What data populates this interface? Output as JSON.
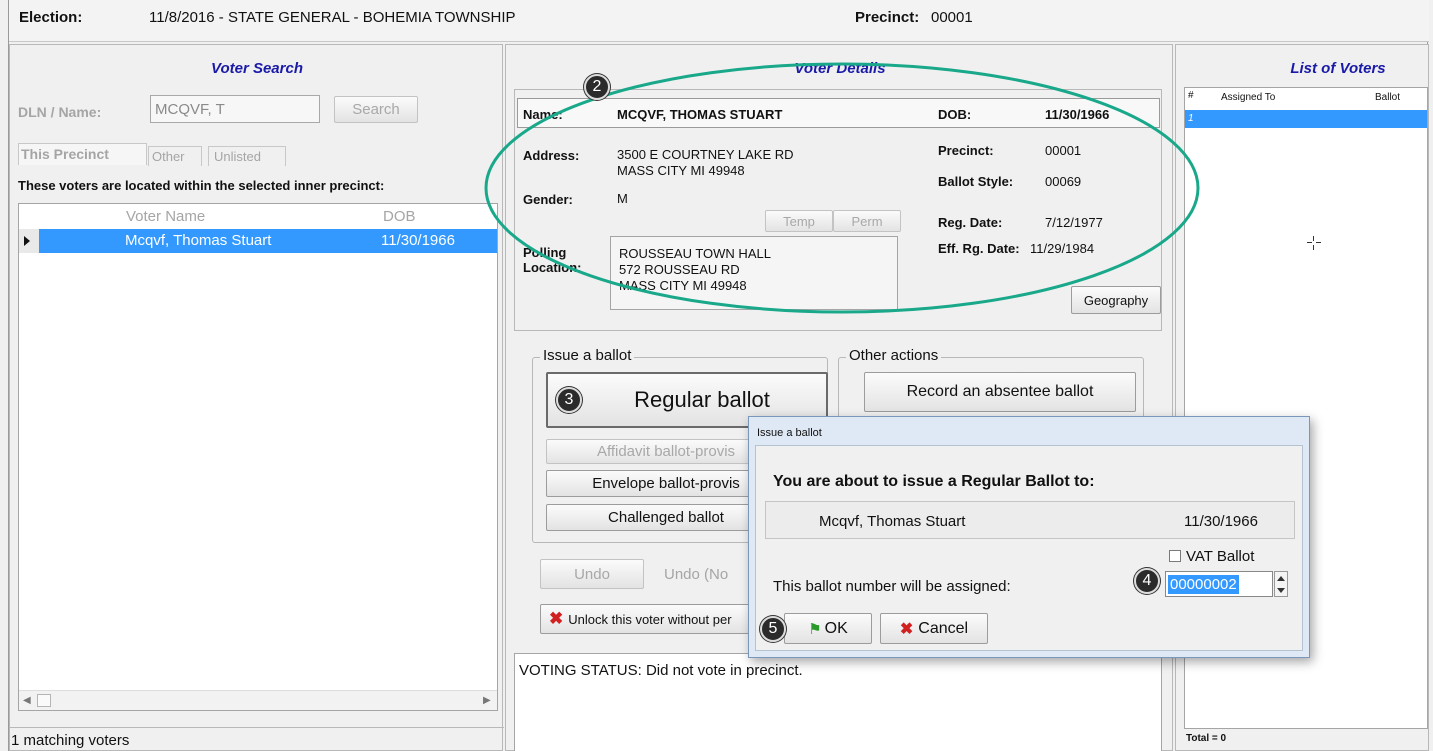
{
  "header": {
    "election_label": "Election:",
    "election_value": "11/8/2016 - STATE GENERAL - BOHEMIA TOWNSHIP",
    "precinct_label": "Precinct:",
    "precinct_value": "00001"
  },
  "voter_search": {
    "title": "Voter Search",
    "dln_label": "DLN / Name:",
    "dln_value": "MCQVF, T",
    "search_button": "Search",
    "tabs": [
      "This Precinct",
      "Other",
      "Unlisted"
    ],
    "notice": "These voters are located within the selected inner precinct:",
    "columns": [
      "Voter Name",
      "DOB"
    ],
    "rows": [
      {
        "name": "Mcqvf, Thomas Stuart",
        "dob": "11/30/1966"
      }
    ],
    "status": "1 matching voters"
  },
  "voter_details": {
    "title": "Voter Details",
    "name_label": "Name:",
    "name_value": "MCQVF, THOMAS STUART",
    "dob_label": "DOB:",
    "dob_value": "11/30/1966",
    "address_label": "Address:",
    "address_line1": "3500 E COURTNEY LAKE RD",
    "address_line2": "MASS CITY MI 49948",
    "precinct_label": "Precinct:",
    "precinct_value": "00001",
    "ballot_style_label": "Ballot Style:",
    "ballot_style_value": "00069",
    "gender_label": "Gender:",
    "gender_value": "M",
    "temp_button": "Temp",
    "perm_button": "Perm",
    "reg_date_label": "Reg. Date:",
    "reg_date_value": "7/12/1977",
    "eff_date_label": "Eff. Rg. Date:",
    "eff_date_value": "11/29/1984",
    "polling_label_1": "Polling",
    "polling_label_2": "Location:",
    "polling_line1": "ROUSSEAU TOWN HALL",
    "polling_line2": "572 ROUSSEAU RD",
    "polling_line3": "MASS CITY MI 49948",
    "geography_button": "Geography"
  },
  "issue_ballot": {
    "group_label": "Issue a ballot",
    "regular": "Regular ballot",
    "affidavit": "Affidavit ballot-provis",
    "envelope": "Envelope ballot-provis",
    "challenged": "Challenged ballot",
    "undo_button": "Undo",
    "undo_text": "Undo (No",
    "unlock_button": "Unlock this voter without per"
  },
  "other_actions": {
    "group_label": "Other actions",
    "absentee": "Record an absentee ballot"
  },
  "voting_status": "VOTING STATUS: Did not vote in precinct.",
  "list_of_voters": {
    "title": "List of Voters",
    "columns": [
      "#",
      "Assigned To",
      "Ballot"
    ],
    "rows": [
      {
        "num": "1"
      }
    ],
    "total": "Total = 0"
  },
  "dialog": {
    "title": "Issue a ballot",
    "heading": "You are about to issue a Regular Ballot to:",
    "voter_name": "Mcqvf, Thomas Stuart",
    "voter_dob": "11/30/1966",
    "vat_label": "VAT Ballot",
    "assign_text": "This ballot number will be assigned:",
    "ballot_number": "00000002",
    "ok_button": "OK",
    "cancel_button": "Cancel"
  },
  "markers": [
    "2",
    "3",
    "4",
    "5"
  ],
  "colors": {
    "title_blue": "#1a1aa8",
    "selection": "#3399ff",
    "callout_green": "#1aa88a",
    "cancel_red": "#d02020",
    "ok_green": "#2a9a2a"
  }
}
